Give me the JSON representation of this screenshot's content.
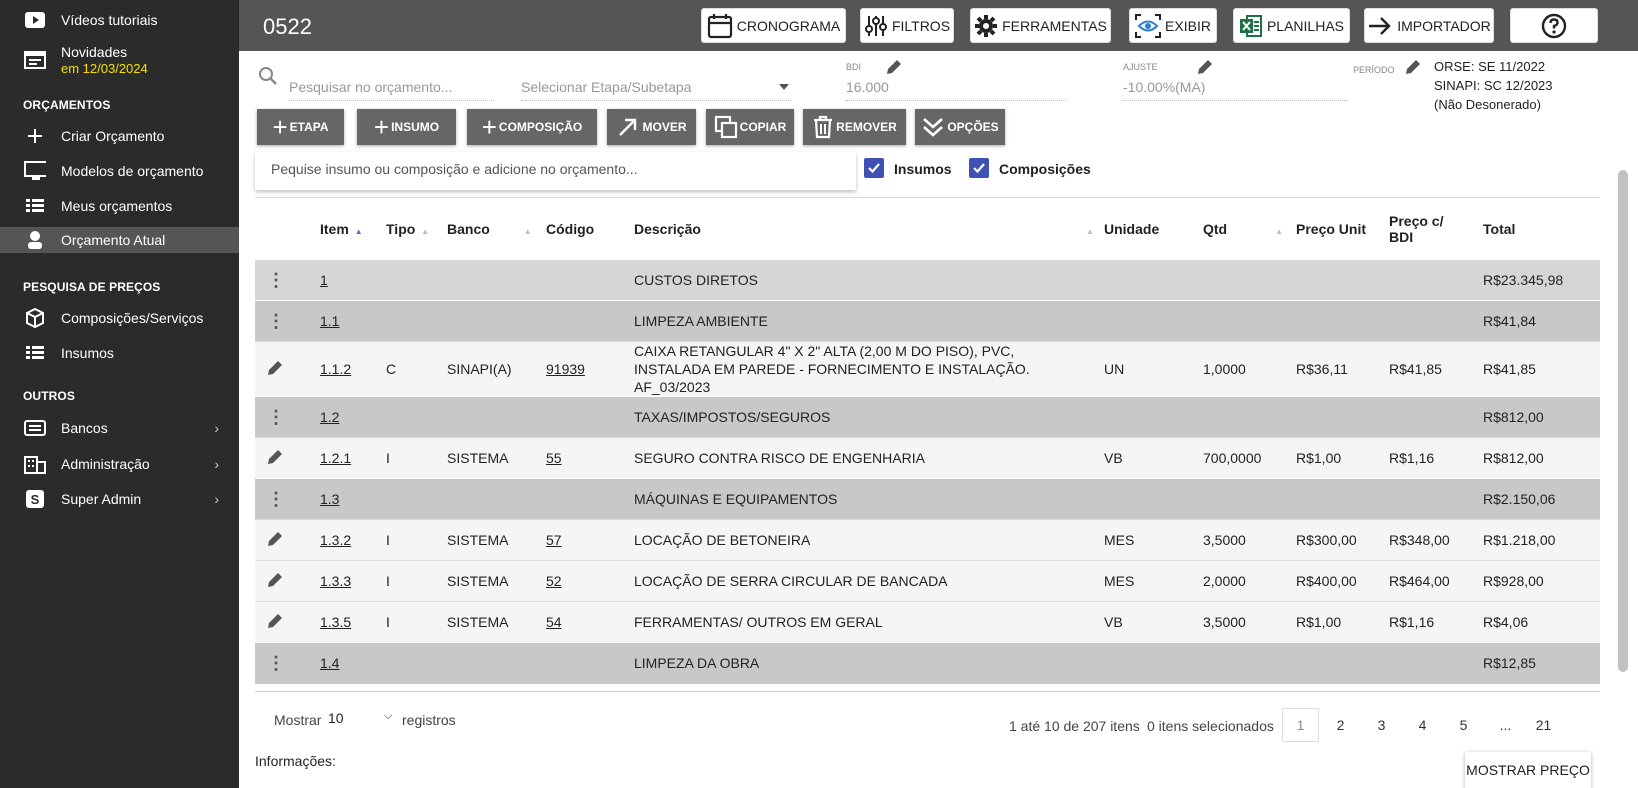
{
  "sidebar": {
    "top_item": "Vídeos tutoriais",
    "news_label": "Novidades",
    "news_date": "em 12/03/2024",
    "section_orcamentos": "ORÇAMENTOS",
    "criar": "Criar Orçamento",
    "modelos": "Modelos de orçamento",
    "meus": "Meus orçamentos",
    "atual": "Orçamento Atual",
    "section_pesquisa": "PESQUISA DE PREÇOS",
    "composicoes": "Composições/Serviços",
    "insumos": "Insumos",
    "section_outros": "OUTROS",
    "bancos": "Bancos",
    "administracao": "Administração",
    "superadmin": "Super Admin",
    "superadmin_badge": "S"
  },
  "topbar": {
    "title": "0522",
    "cronograma": "CRONOGRAMA",
    "filtros": "FILTROS",
    "ferramentas": "FERRAMENTAS",
    "exibir": "EXIBIR",
    "planilhas": "PLANILHAS",
    "importador": "IMPORTADOR"
  },
  "filters": {
    "search_placeholder": "Pesquisar no orçamento...",
    "etapa_placeholder": "Selecionar Etapa/Subetapa",
    "bdi_label": "BDI",
    "bdi_value": "16.000",
    "ajuste_label": "AJUSTE",
    "ajuste_value": "-10.00%(MA)",
    "periodo_label": "PERÍODO",
    "periodo_line1": "ORSE: SE 11/2022",
    "periodo_line2": "SINAPI: SC 12/2023",
    "periodo_line3": "(Não Desonerado)"
  },
  "actions": {
    "etapa": "ETAPA",
    "insumo": "INSUMO",
    "composicao": "COMPOSIÇÃO",
    "mover": "MOVER",
    "copiar": "COPIAR",
    "remover": "REMOVER",
    "opcoes": "OPÇÕES"
  },
  "addsearch": {
    "placeholder": "Pequise insumo ou composição e adicione no orçamento...",
    "insumos_label": "Insumos",
    "composicoes_label": "Composições"
  },
  "table": {
    "headers": {
      "item": "Item",
      "tipo": "Tipo",
      "banco": "Banco",
      "codigo": "Código",
      "descricao": "Descrição",
      "unidade": "Unidade",
      "qtd": "Qtd",
      "preco_unit": "Preço Unit",
      "preco_bdi_1": "Preço c/",
      "preco_bdi_2": "BDI",
      "total": "Total"
    },
    "rows": [
      {
        "kind": "grp",
        "item": "1",
        "tipo": "",
        "banco": "",
        "codigo": "",
        "descricao": "CUSTOS DIRETOS",
        "unidade": "",
        "qtd": "",
        "preco_unit": "",
        "preco_bdi": "",
        "total": "R$23.345,98"
      },
      {
        "kind": "grp",
        "item": "1.1",
        "tipo": "",
        "banco": "",
        "codigo": "",
        "descricao": "LIMPEZA AMBIENTE",
        "unidade": "",
        "qtd": "",
        "preco_unit": "",
        "preco_bdi": "",
        "total": "R$41,84"
      },
      {
        "kind": "itm",
        "item": "1.1.2",
        "tipo": "C",
        "banco": "SINAPI(A)",
        "codigo": "91939",
        "descricao": "CAIXA RETANGULAR 4\" X 2\" ALTA (2,00 M DO PISO), PVC, INSTALADA EM PAREDE - FORNECIMENTO E INSTALAÇÃO. AF_03/2023",
        "unidade": "UN",
        "qtd": "1,0000",
        "preco_unit": "R$36,11",
        "preco_bdi": "R$41,85",
        "total": "R$41,85"
      },
      {
        "kind": "grp",
        "item": "1.2",
        "tipo": "",
        "banco": "",
        "codigo": "",
        "descricao": "TAXAS/IMPOSTOS/SEGUROS",
        "unidade": "",
        "qtd": "",
        "preco_unit": "",
        "preco_bdi": "",
        "total": "R$812,00"
      },
      {
        "kind": "itm",
        "item": "1.2.1",
        "tipo": "I",
        "banco": "SISTEMA",
        "codigo": "55",
        "descricao": "SEGURO CONTRA RISCO DE ENGENHARIA",
        "unidade": "VB",
        "qtd": "700,0000",
        "preco_unit": "R$1,00",
        "preco_bdi": "R$1,16",
        "total": "R$812,00"
      },
      {
        "kind": "grp",
        "item": "1.3",
        "tipo": "",
        "banco": "",
        "codigo": "",
        "descricao": "MÁQUINAS E EQUIPAMENTOS",
        "unidade": "",
        "qtd": "",
        "preco_unit": "",
        "preco_bdi": "",
        "total": "R$2.150,06"
      },
      {
        "kind": "itm",
        "item": "1.3.2",
        "tipo": "I",
        "banco": "SISTEMA",
        "codigo": "57",
        "descricao": "LOCAÇÃO DE BETONEIRA",
        "unidade": "MES",
        "qtd": "3,5000",
        "preco_unit": "R$300,00",
        "preco_bdi": "R$348,00",
        "total": "R$1.218,00"
      },
      {
        "kind": "itm",
        "item": "1.3.3",
        "tipo": "I",
        "banco": "SISTEMA",
        "codigo": "52",
        "descricao": "LOCAÇÃO DE SERRA CIRCULAR DE BANCADA",
        "unidade": "MES",
        "qtd": "2,0000",
        "preco_unit": "R$400,00",
        "preco_bdi": "R$464,00",
        "total": "R$928,00"
      },
      {
        "kind": "itm",
        "item": "1.3.5",
        "tipo": "I",
        "banco": "SISTEMA",
        "codigo": "54",
        "descricao": "FERRAMENTAS/ OUTROS EM GERAL",
        "unidade": "VB",
        "qtd": "3,5000",
        "preco_unit": "R$1,00",
        "preco_bdi": "R$1,16",
        "total": "R$4,06"
      },
      {
        "kind": "grp",
        "item": "1.4",
        "tipo": "",
        "banco": "",
        "codigo": "",
        "descricao": "LIMPEZA DA OBRA",
        "unidade": "",
        "qtd": "",
        "preco_unit": "",
        "preco_bdi": "",
        "total": "R$12,85"
      }
    ]
  },
  "footer": {
    "mostrar": "Mostrar",
    "page_size": "10",
    "registros": "registros",
    "range": "1 até 10 de 207 itens",
    "selected": "0 itens selecionados",
    "pages": [
      "1",
      "2",
      "3",
      "4",
      "5",
      "...",
      "21"
    ],
    "informacoes": "Informações:",
    "mostrar_preco": "MOSTRAR PREÇO"
  }
}
